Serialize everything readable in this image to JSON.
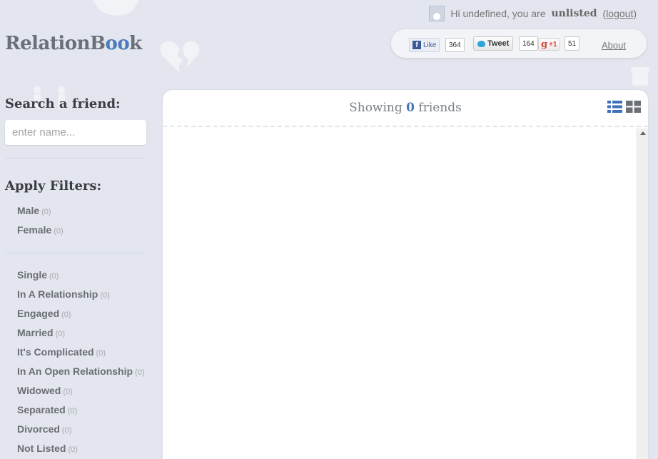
{
  "header": {
    "logo_prefix": "RelationB",
    "logo_accent": "oo",
    "logo_suffix": "k",
    "greeting": "Hi undefined, you are",
    "status": "unlisted",
    "logout_label": "(logout)"
  },
  "social": {
    "fb_label": "Like",
    "fb_count": "364",
    "tweet_label": "Tweet",
    "tweet_count": "164",
    "gplus_label": "+1",
    "gplus_count": "51",
    "about_label": "About"
  },
  "sidebar": {
    "search_heading": "Search a friend:",
    "search_placeholder": "enter name...",
    "filters_heading": "Apply Filters:",
    "gender_filters": [
      {
        "label": "Male",
        "count": "(0)"
      },
      {
        "label": "Female",
        "count": "(0)"
      }
    ],
    "relationship_filters": [
      {
        "label": "Single",
        "count": "(0)"
      },
      {
        "label": "In A Relationship",
        "count": "(0)"
      },
      {
        "label": "Engaged",
        "count": "(0)"
      },
      {
        "label": "Married",
        "count": "(0)"
      },
      {
        "label": "It's Complicated",
        "count": "(0)"
      },
      {
        "label": "In An Open Relationship",
        "count": "(0)"
      },
      {
        "label": "Widowed",
        "count": "(0)"
      },
      {
        "label": "Separated",
        "count": "(0)"
      },
      {
        "label": "Divorced",
        "count": "(0)"
      },
      {
        "label": "Not Listed",
        "count": "(0)"
      }
    ]
  },
  "main": {
    "showing_prefix": "Showing",
    "friend_count": "0",
    "showing_suffix": "friends"
  },
  "colors": {
    "background": "#e3e6ee",
    "accent": "#4a74b8",
    "panel": "#ffffff"
  }
}
